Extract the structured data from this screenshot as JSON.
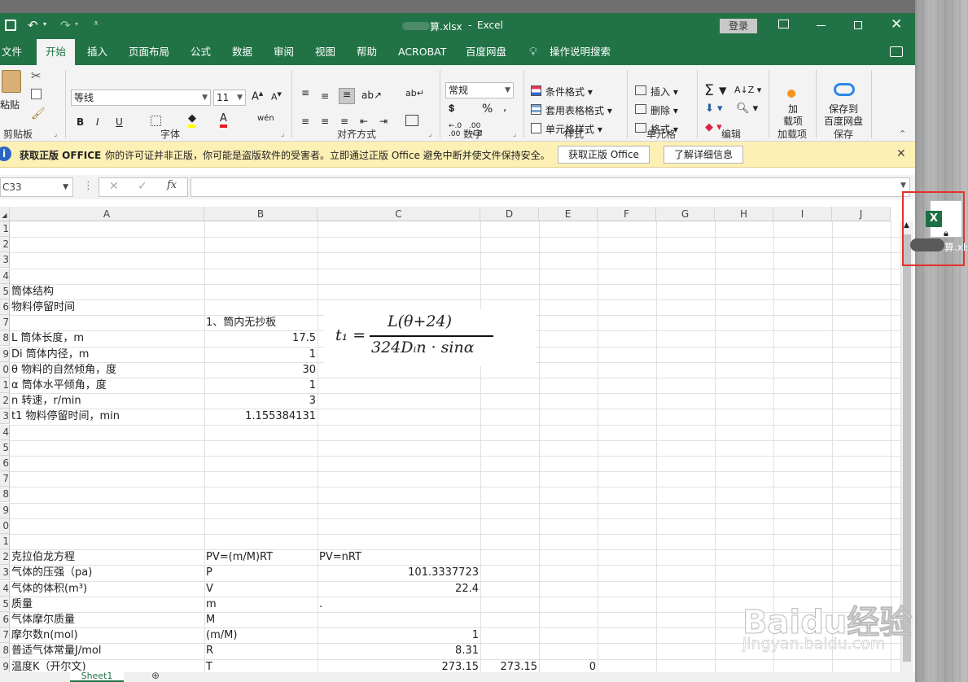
{
  "title": {
    "filename": "算.xlsx",
    "app": "Excel",
    "login": "登录"
  },
  "tabs": [
    "文件",
    "开始",
    "插入",
    "页面布局",
    "公式",
    "数据",
    "审阅",
    "视图",
    "帮助",
    "ACROBAT",
    "百度网盘",
    "操作说明搜索"
  ],
  "ribbon": {
    "paste": "粘贴",
    "font_name": "等线",
    "font_size": "11",
    "number_format": "常规",
    "conditional": "条件格式",
    "table_format": "套用表格格式",
    "cell_style": "单元格样式",
    "insert": "插入",
    "delete": "删除",
    "format": "格式",
    "addin": "加\n载项",
    "baidu_save": "保存到\n百度网盘",
    "groups": [
      "剪贴板",
      "字体",
      "对齐方式",
      "数字",
      "样式",
      "单元格",
      "编辑",
      "加载项",
      "保存"
    ]
  },
  "message": {
    "title": "获取正版 OFFICE",
    "text": "你的许可证并非正版，你可能是盗版软件的受害者。立即通过正版 Office 避免中断并使文件保持安全。",
    "btn1": "获取正版 Office",
    "btn2": "了解详细信息"
  },
  "namebox": "C33",
  "formula_symbols": {
    "fx": "fx"
  },
  "columns": [
    "A",
    "B",
    "C",
    "D",
    "E",
    "F",
    "G",
    "H",
    "I",
    "J"
  ],
  "row_numbers": [
    "1",
    "2",
    "3",
    "4",
    "5",
    "6",
    "7",
    "8",
    "9",
    "0",
    "1",
    "2",
    "3",
    "4",
    "5",
    "6",
    "7",
    "8",
    "9",
    "0",
    "1",
    "2",
    "3",
    "4",
    "5",
    "6",
    "7",
    "8",
    "9"
  ],
  "rows": [
    {
      "a": "",
      "b": "",
      "c": ""
    },
    {
      "a": "",
      "b": "",
      "c": ""
    },
    {
      "a": "",
      "b": "",
      "c": ""
    },
    {
      "a": "",
      "b": "",
      "c": ""
    },
    {
      "a": "筒体结构",
      "b": "",
      "c": ""
    },
    {
      "a": "物料停留时间",
      "b": "",
      "c": ""
    },
    {
      "a": "",
      "b": "1、筒内无抄板",
      "c": ""
    },
    {
      "a": "L 筒体长度，m",
      "b": "17.5",
      "c": ""
    },
    {
      "a": "Di 筒体内径，m",
      "b": "1",
      "c": ""
    },
    {
      "a": "θ 物料的自然倾角，度",
      "b": "30",
      "c": ""
    },
    {
      "a": "α 筒体水平倾角，度",
      "b": "1",
      "c": ""
    },
    {
      "a": "n 转速，r/min",
      "b": "3",
      "c": ""
    },
    {
      "a": "t1 物料停留时间，min",
      "b": "1.155384131",
      "c": ""
    },
    {
      "a": "",
      "b": "",
      "c": ""
    },
    {
      "a": "",
      "b": "",
      "c": ""
    },
    {
      "a": "",
      "b": "",
      "c": ""
    },
    {
      "a": "",
      "b": "",
      "c": ""
    },
    {
      "a": "",
      "b": "",
      "c": ""
    },
    {
      "a": "",
      "b": "",
      "c": ""
    },
    {
      "a": "",
      "b": "",
      "c": ""
    },
    {
      "a": "",
      "b": "",
      "c": ""
    },
    {
      "a": "克拉伯龙方程",
      "b": "PV=(m/M)RT",
      "c": "PV=nRT"
    },
    {
      "a": "气体的压强（pa)",
      "b": "P",
      "c": "101.3337723"
    },
    {
      "a": "气体的体积(m³)",
      "b": "V",
      "c": "22.4"
    },
    {
      "a": "质量",
      "b": "m",
      "c": "."
    },
    {
      "a": "气体摩尔质量",
      "b": "M",
      "c": ""
    },
    {
      "a": "摩尔数n(mol)",
      "b": "(m/M)",
      "c": "1"
    },
    {
      "a": "普适气体常量J/mol",
      "b": "R",
      "c": "8.31"
    },
    {
      "a": "温度K（开尔文)",
      "b": "T",
      "c": "273.15",
      "d": "273.15",
      "e": "0"
    }
  ],
  "formula_image": {
    "lhs": "t₁ =",
    "numerator": "L(θ+24)",
    "denominator": "324Dᵢn · sinα"
  },
  "sheet_tab": "Sheet1",
  "desktop_file": {
    "label": "算.xlsx"
  },
  "watermark": {
    "line1": "Baidu经验",
    "line2": "jingyan.baidu.com"
  }
}
